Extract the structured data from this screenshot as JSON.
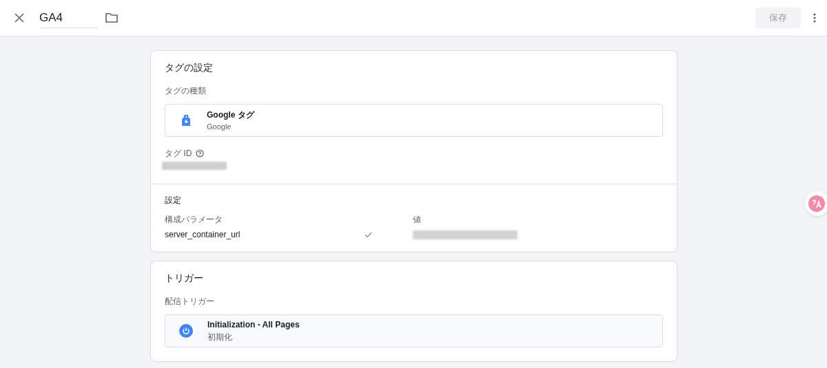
{
  "toolbar": {
    "title": "GA4",
    "save_button": {
      "label": "保存",
      "disabled": true
    }
  },
  "tag_settings": {
    "heading": "タグの設定",
    "type_label": "タグの種類",
    "tag_type": {
      "name": "Google タグ",
      "vendor": "Google"
    },
    "id_label": "タグ ID",
    "settings_heading": "設定",
    "param_columns": [
      "構成パラメータ",
      "値"
    ],
    "params": [
      {
        "name": "server_container_url",
        "checked": true
      }
    ]
  },
  "triggering": {
    "heading": "トリガー",
    "label": "配信トリガー",
    "triggers": [
      {
        "name": "Initialization - All Pages",
        "type": "初期化"
      }
    ]
  }
}
